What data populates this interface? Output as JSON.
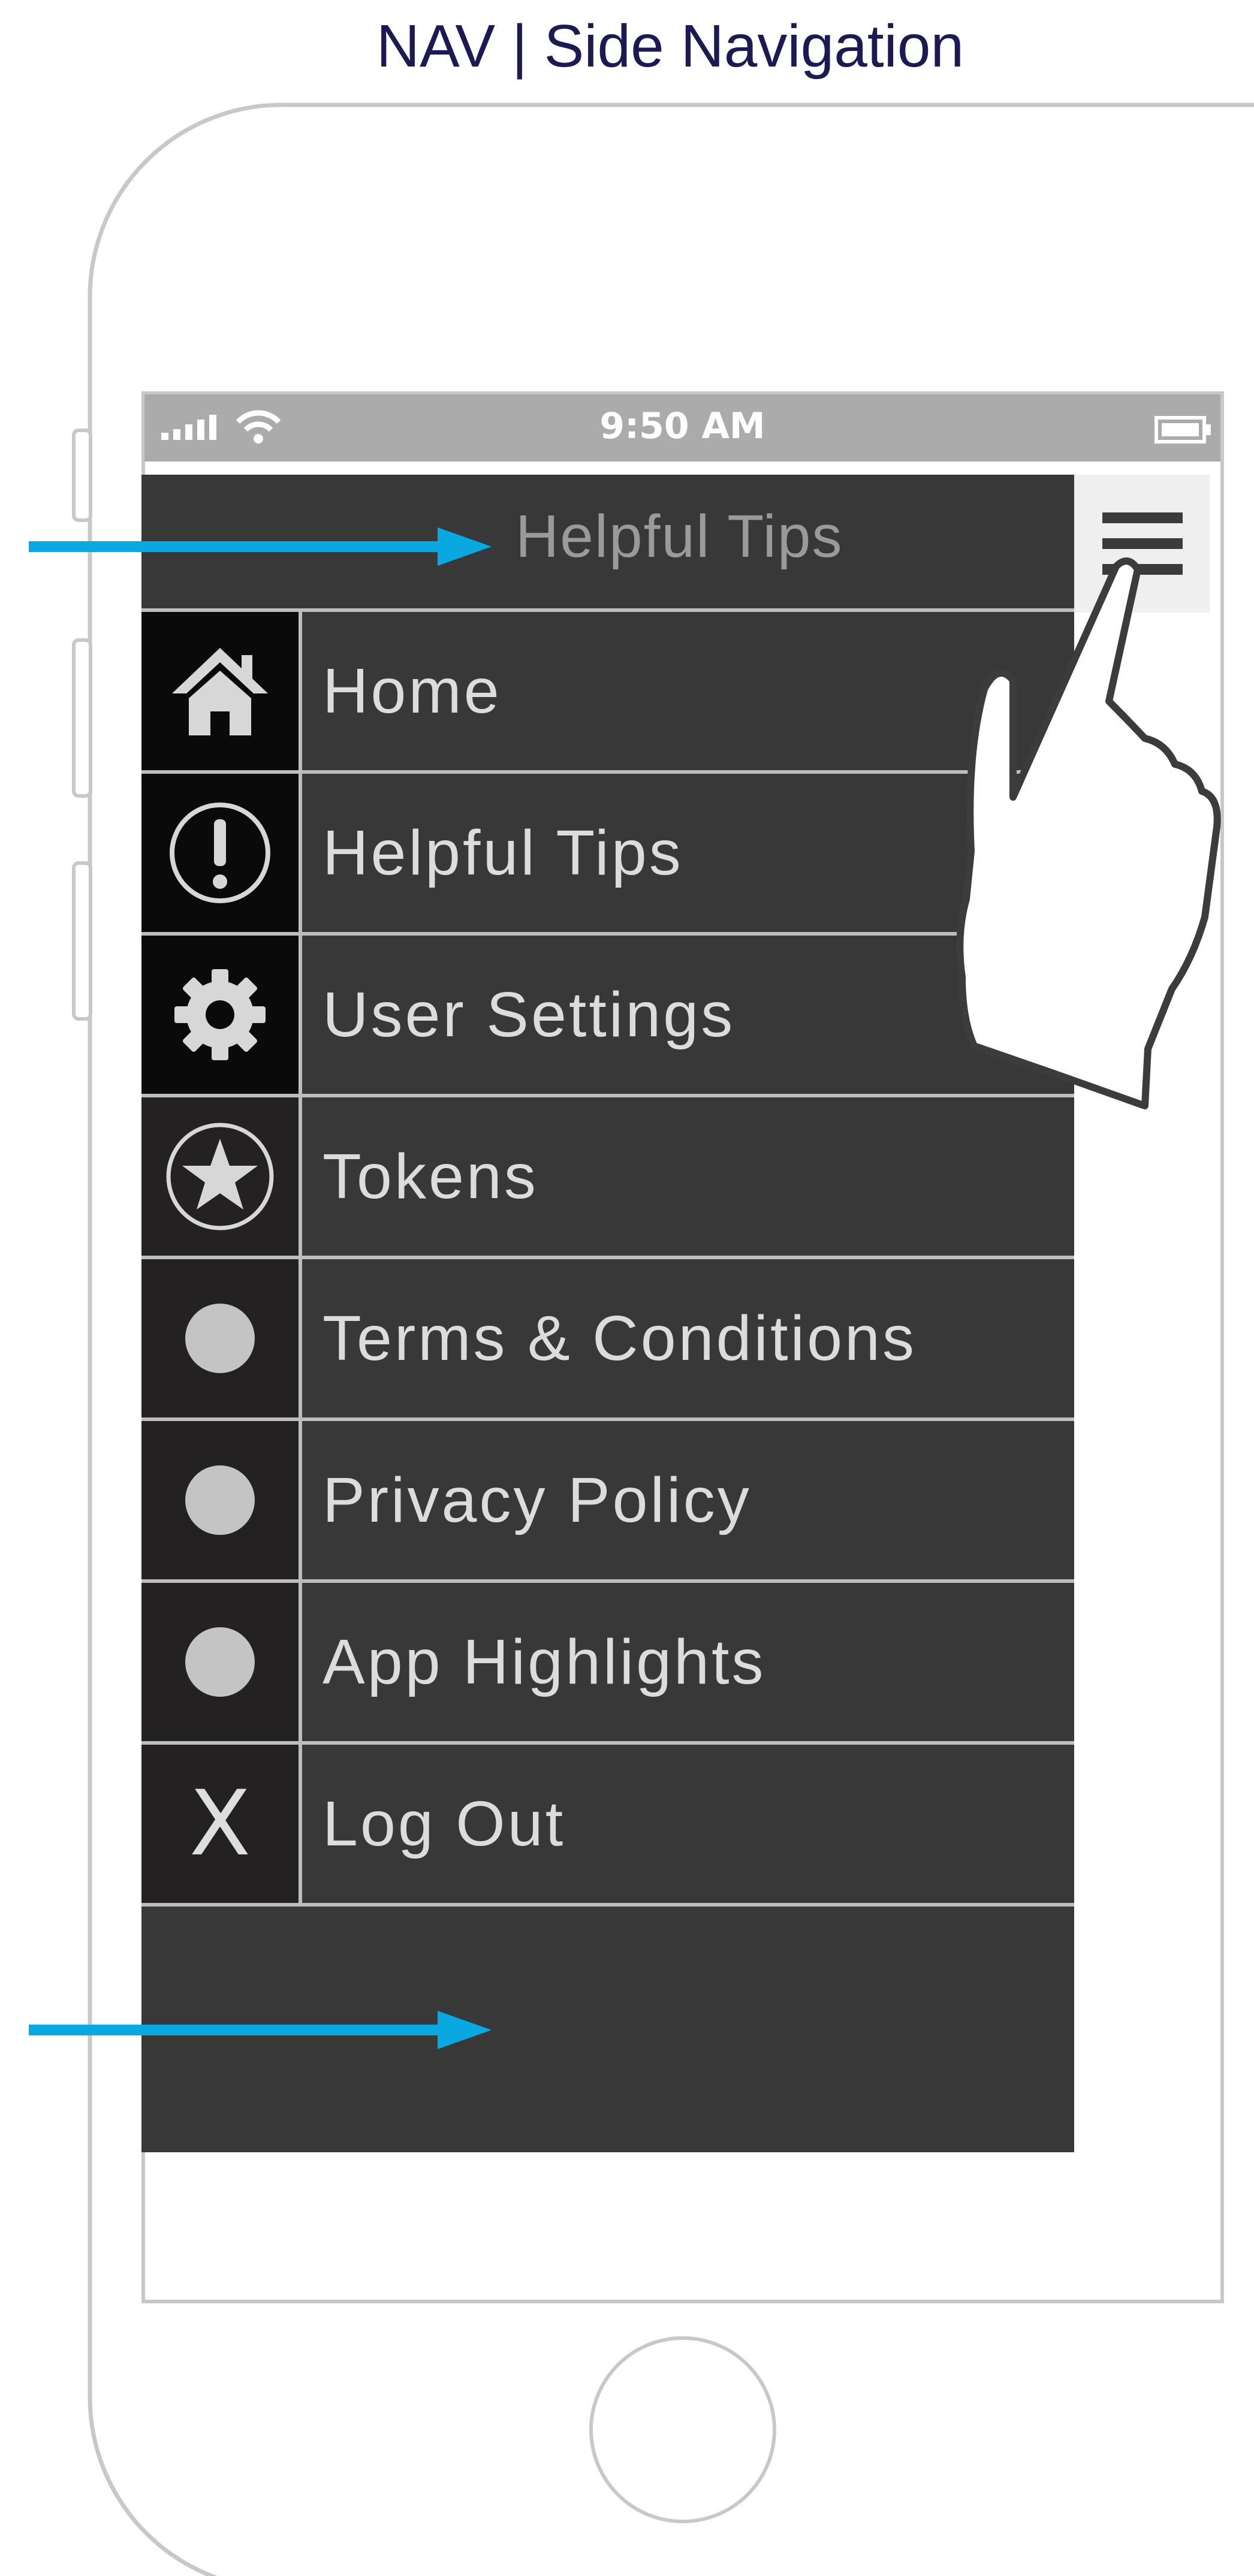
{
  "page_title": "NAV | Side Navigation",
  "status_bar": {
    "time": "9:50 AM",
    "icons": [
      "signal-icon",
      "wifi-icon",
      "battery-icon"
    ]
  },
  "header": {
    "title": "Helpful Tips",
    "menu_icon": "hamburger-icon"
  },
  "menu": {
    "items": [
      {
        "label": "Home",
        "icon": "house-icon"
      },
      {
        "label": "Helpful Tips",
        "icon": "exclamation-icon"
      },
      {
        "label": "User Settings",
        "icon": "gear-icon"
      },
      {
        "label": "Tokens",
        "icon": "star-icon"
      },
      {
        "label": "Terms & Conditions",
        "icon": "dot-icon"
      },
      {
        "label": "Privacy Policy",
        "icon": "dot-icon"
      },
      {
        "label": "App Highlights",
        "icon": "dot-icon"
      },
      {
        "label": "Log Out",
        "icon": "x-icon",
        "icon_text": "X"
      }
    ]
  },
  "colors": {
    "panel": "#383838",
    "icon_cell": "#232122",
    "arrow": "#0aa8e0",
    "title": "#1c1a55",
    "status_bar": "#ababab"
  }
}
